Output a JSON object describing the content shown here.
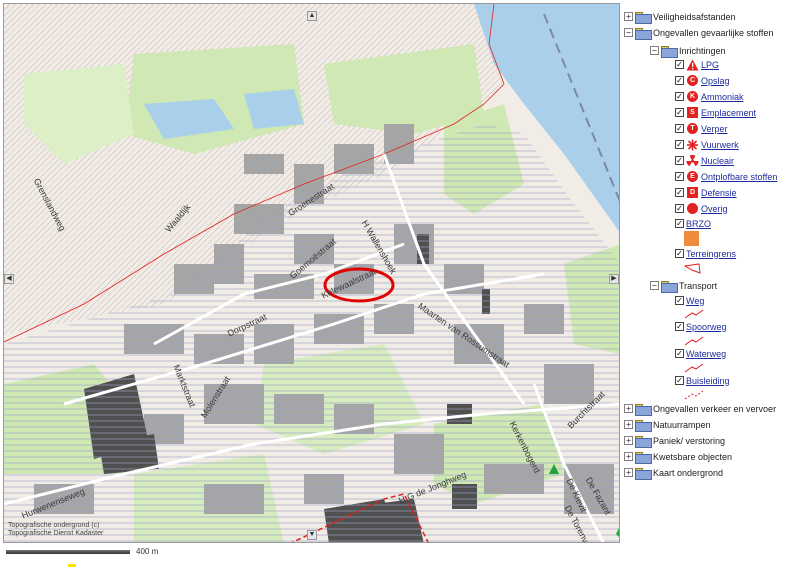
{
  "map": {
    "streets": [
      {
        "id": "grensweg",
        "text": "Grenslandweg"
      },
      {
        "id": "waaldijk",
        "text": "Waaldijk"
      },
      {
        "id": "groenestraat",
        "text": "Groenestraat"
      },
      {
        "id": "wallenshoek",
        "text": "H Wallenshoek"
      },
      {
        "id": "goeroestraat",
        "text": "Goemoëstraat"
      },
      {
        "id": "kolewaalstraat",
        "text": "Kolewaalstraat"
      },
      {
        "id": "maarten",
        "text": "Maarten van Rossumstraat"
      },
      {
        "id": "dorpstraat",
        "text": "Dorpstraat"
      },
      {
        "id": "molenstraat",
        "text": "Molenstraat"
      },
      {
        "id": "marktstraat",
        "text": "Marktstraat"
      },
      {
        "id": "hurwenenseweg",
        "text": "Hurwenenseweg"
      },
      {
        "id": "hgdejonghweg",
        "text": "H G de Jonghweg"
      },
      {
        "id": "kerkenbogerd",
        "text": "Kerkenbogerd"
      },
      {
        "id": "burchtstraat",
        "text": "Burchtstraat"
      },
      {
        "id": "dekievit",
        "text": "De Kievit"
      },
      {
        "id": "detorenvalk",
        "text": "De Torenvalk"
      },
      {
        "id": "defazant",
        "text": "De Fazant"
      }
    ],
    "copyright_line1": "Topografische ondergrond (c)",
    "copyright_line2": "Topografische Dienst Kadaster",
    "scale_label": "400 m",
    "colors": {
      "background": "#f3efe7",
      "river": "#a9cfea",
      "green": "#cfe8b4",
      "building": "#a5a5a5",
      "building_dark": "#505050",
      "hatch": "#9aa0c8",
      "highlight_circle": "#e00000",
      "border_red": "#e02020"
    }
  },
  "layers": {
    "veiligheid": "Veiligheidsafstanden",
    "ongevallen_gevaarlijk": "Ongevallen gevaarlijke stoffen",
    "inrichtingen": "Inrichtingen",
    "items": [
      {
        "label": "LPG",
        "icon": "triangle-warning",
        "letter": ""
      },
      {
        "label": "Opslag",
        "icon": "circle-letter",
        "letter": "C"
      },
      {
        "label": "Ammoniak",
        "icon": "circle-letter",
        "letter": "K"
      },
      {
        "label": "Emplacement",
        "icon": "square-letter",
        "letter": "S"
      },
      {
        "label": "Verper",
        "icon": "circle-letter",
        "letter": "T"
      },
      {
        "label": "Vuurwerk",
        "icon": "firework",
        "letter": ""
      },
      {
        "label": "Nucleair",
        "icon": "radiation",
        "letter": ""
      },
      {
        "label": "Ontplofbare stoffen",
        "icon": "circle-letter",
        "letter": "E"
      },
      {
        "label": "Defensie",
        "icon": "square-letter",
        "letter": "D"
      },
      {
        "label": "Overig",
        "icon": "circle-plain",
        "letter": ""
      }
    ],
    "brzo": "BRZO",
    "terreingrens": "Terreingrens",
    "transport": "Transport",
    "transport_items": [
      "Weg",
      "Spoorweg",
      "Waterweg",
      "Buisleiding"
    ],
    "bottom_groups": [
      "Ongevallen verkeer en vervoer",
      "Natuurrampen",
      "Paniek/ verstoring",
      "Kwetsbare objecten",
      "Kaart ondergrond"
    ],
    "colors": {
      "icon_red": "#e22121",
      "brzo_orange": "#f08a3c",
      "link": "#1d2c9c"
    }
  }
}
